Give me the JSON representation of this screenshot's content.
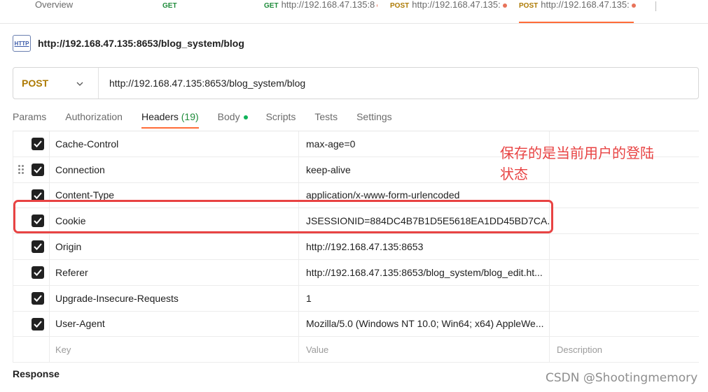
{
  "tabstrip": {
    "tabs": [
      {
        "method": "",
        "label": "Overview"
      },
      {
        "method": "GET",
        "label": ""
      },
      {
        "method": "GET",
        "label": "http://192.168.47.135:8"
      },
      {
        "method": "POST",
        "label": "http://192.168.47.135:"
      },
      {
        "method": "POST",
        "label": "http://192.168.47.135:"
      }
    ]
  },
  "request": {
    "title": "http://192.168.47.135:8653/blog_system/blog",
    "icon": "HTTP",
    "method": "POST",
    "url": "http://192.168.47.135:8653/blog_system/blog"
  },
  "subtabs": {
    "params": "Params",
    "authorization": "Authorization",
    "headers": "Headers",
    "headers_count": "(19)",
    "body": "Body",
    "scripts": "Scripts",
    "tests": "Tests",
    "settings": "Settings"
  },
  "headers": [
    {
      "key": "Cache-Control",
      "value": "max-age=0"
    },
    {
      "key": "Connection",
      "value": "keep-alive"
    },
    {
      "key": "Content-Type",
      "value": "application/x-www-form-urlencoded"
    },
    {
      "key": "Cookie",
      "value": "JSESSIONID=884DC4B7B1D5E5618EA1DD45BD7CA..."
    },
    {
      "key": "Origin",
      "value": "http://192.168.47.135:8653"
    },
    {
      "key": "Referer",
      "value": "http://192.168.47.135:8653/blog_system/blog_edit.ht..."
    },
    {
      "key": "Upgrade-Insecure-Requests",
      "value": "1"
    },
    {
      "key": "User-Agent",
      "value": "Mozilla/5.0 (Windows NT 10.0; Win64; x64) AppleWe..."
    }
  ],
  "placeholder": {
    "key": "Key",
    "value": "Value",
    "description": "Description"
  },
  "annotation": "保存的是当前用户的登陆状态",
  "response_label": "Response",
  "watermark": "CSDN @Shootingmemory",
  "colors": {
    "accent": "#ff6c37",
    "method": "#ad7a03",
    "annotation": "#e84343"
  }
}
